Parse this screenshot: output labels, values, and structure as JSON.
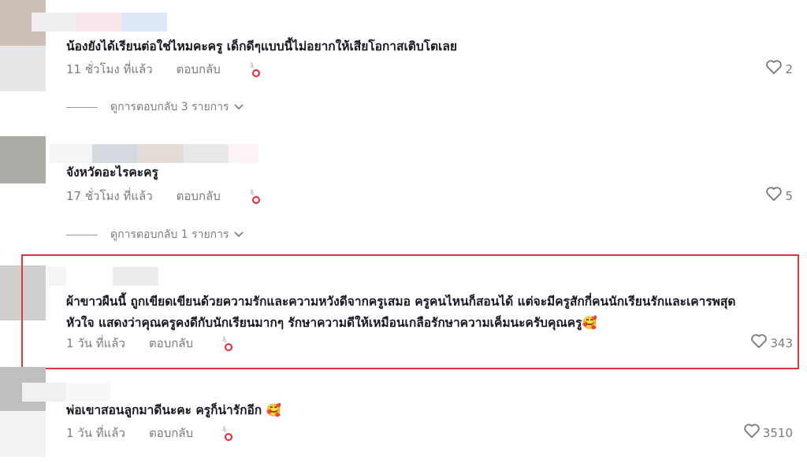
{
  "comments": [
    {
      "text": "น้องยังได้เรียนต่อใช่ไหมคะครู เด็กดีๆแบบนี้ไม่อยากให้เสียโอกาสเติบโตเลย",
      "time": "11 ชั่วโมง ที่แล้ว",
      "reply_label": "ตอบกลับ",
      "likes": "2",
      "view_replies": "ดูการตอบกลับ 3 รายการ"
    },
    {
      "text": "จังหวัดอะไรคะครู",
      "time": "17 ชั่วโมง ที่แล้ว",
      "reply_label": "ตอบกลับ",
      "likes": "5",
      "view_replies": "ดูการตอบกลับ 1 รายการ"
    },
    {
      "text_line1": "ผ้าขาวผืนนี้ ถูกเขียดเขียนด้วยความรักและความหวังดีจากครูเสมอ ครูคนไหนก็สอนได้ แต่จะมีครูสักกี่คนนักเรียนรักและเคารพสุด",
      "text_line2": "หัวใจ แสดงว่าคุณครูคงดีกับนักเรียนมากๆ รักษาความดีให้เหมือนเกลือรักษาความเค็มนะครับคุณครู",
      "emoji": "🥰",
      "time": "1 วัน ที่แล้ว",
      "reply_label": "ตอบกลับ",
      "likes": "343"
    },
    {
      "text": "พ่อเขาสอนลูกมาดีนะคะ ครูก็น่ารักอีก",
      "emoji": "🥰",
      "time": "1 วัน ที่แล้ว",
      "reply_label": "ตอบกลับ",
      "likes": "3510"
    }
  ],
  "colors": {
    "highlight_border": "#e0393b",
    "meta_text": "#7a7b80",
    "body_text": "#161823"
  }
}
